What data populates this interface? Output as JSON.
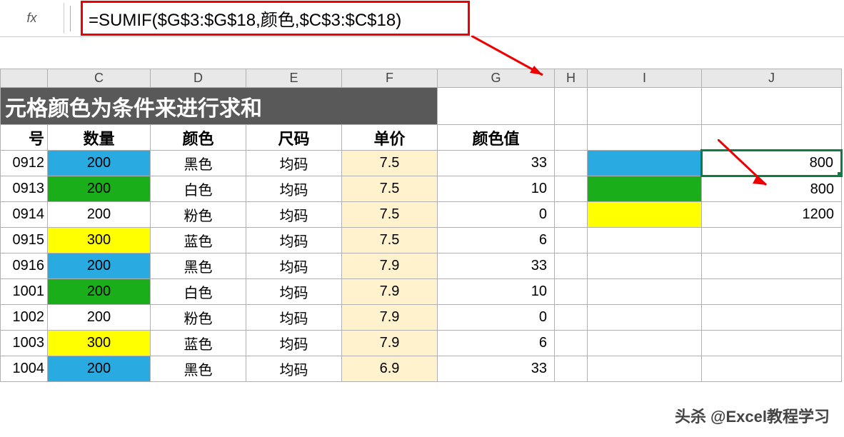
{
  "formula_bar": {
    "fx_icon": "fx",
    "formula": "=SUMIF($G$3:$G$18,颜色,$C$3:$C$18)"
  },
  "columns": {
    "B": "",
    "C": "C",
    "D": "D",
    "E": "E",
    "F": "F",
    "G": "G",
    "H": "H",
    "I": "I",
    "J": "J"
  },
  "title": "元格颜色为条件来进行求和",
  "headers": {
    "B": "号",
    "C": "数量",
    "D": "颜色",
    "E": "尺码",
    "F": "单价",
    "G": "颜色值"
  },
  "rows": [
    {
      "id": "0912",
      "qty": "200",
      "qfill": "blue",
      "color": "黑色",
      "size": "均码",
      "price": "7.5",
      "cval": "33"
    },
    {
      "id": "0913",
      "qty": "200",
      "qfill": "green",
      "color": "白色",
      "size": "均码",
      "price": "7.5",
      "cval": "10"
    },
    {
      "id": "0914",
      "qty": "200",
      "qfill": "none",
      "color": "粉色",
      "size": "均码",
      "price": "7.5",
      "cval": "0"
    },
    {
      "id": "0915",
      "qty": "300",
      "qfill": "yellow",
      "color": "蓝色",
      "size": "均码",
      "price": "7.5",
      "cval": "6"
    },
    {
      "id": "0916",
      "qty": "200",
      "qfill": "blue",
      "color": "黑色",
      "size": "均码",
      "price": "7.9",
      "cval": "33"
    },
    {
      "id": "1001",
      "qty": "200",
      "qfill": "green",
      "color": "白色",
      "size": "均码",
      "price": "7.9",
      "cval": "10"
    },
    {
      "id": "1002",
      "qty": "200",
      "qfill": "none",
      "color": "粉色",
      "size": "均码",
      "price": "7.9",
      "cval": "0"
    },
    {
      "id": "1003",
      "qty": "300",
      "qfill": "yellow",
      "color": "蓝色",
      "size": "均码",
      "price": "7.9",
      "cval": "6"
    },
    {
      "id": "1004",
      "qty": "200",
      "qfill": "blue",
      "color": "黑色",
      "size": "均码",
      "price": "6.9",
      "cval": "33"
    }
  ],
  "side": [
    {
      "fill": "blue",
      "sum": "800",
      "selected": true
    },
    {
      "fill": "green",
      "sum": "800"
    },
    {
      "fill": "yellow",
      "sum": "1200"
    }
  ],
  "watermark": "头杀 @Excel教程学习",
  "colors": {
    "blue": "#29abe2",
    "green": "#1aaf1a",
    "yellow": "#ffff00",
    "cream": "#fff2cc"
  }
}
